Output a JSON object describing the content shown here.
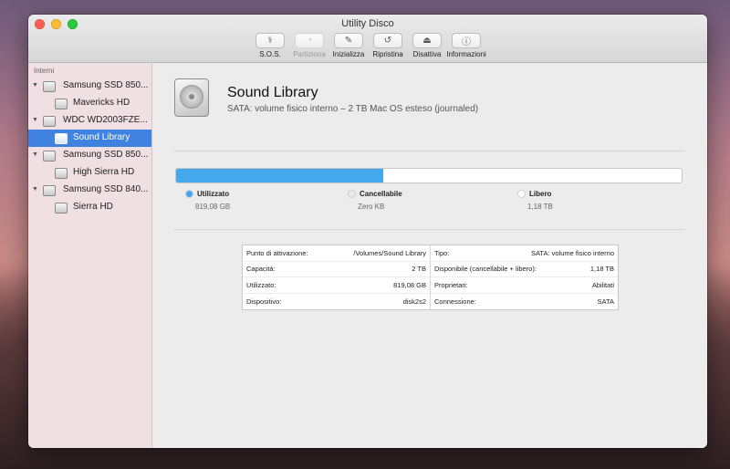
{
  "window": {
    "title": "Utility Disco"
  },
  "toolbar": [
    {
      "label": "S.O.S.",
      "icon": "stethoscope-icon",
      "glyph": "⚕",
      "enabled": true
    },
    {
      "label": "Partiziona",
      "icon": "pie-icon",
      "glyph": "◔",
      "enabled": false
    },
    {
      "label": "Inizializza",
      "icon": "erase-icon",
      "glyph": "✎",
      "enabled": true
    },
    {
      "label": "Ripristina",
      "icon": "restore-icon",
      "glyph": "↺",
      "enabled": true
    },
    {
      "label": "Disattiva",
      "icon": "unmount-icon",
      "glyph": "⏏",
      "enabled": true
    },
    {
      "label": "Informazioni",
      "icon": "info-icon",
      "glyph": "ⓘ",
      "enabled": true
    }
  ],
  "sidebar": {
    "header": "Interni",
    "items": [
      {
        "label": "Samsung SSD 850...",
        "level": "disk",
        "expanded": true,
        "selected": false
      },
      {
        "label": "Mavericks HD",
        "level": "vol",
        "selected": false
      },
      {
        "label": "WDC WD2003FZE...",
        "level": "disk",
        "expanded": true,
        "selected": false
      },
      {
        "label": "Sound Library",
        "level": "vol",
        "selected": true
      },
      {
        "label": "Samsung SSD 850...",
        "level": "disk",
        "expanded": true,
        "selected": false
      },
      {
        "label": "High Sierra HD",
        "level": "vol",
        "selected": false
      },
      {
        "label": "Samsung SSD 840...",
        "level": "disk",
        "expanded": true,
        "selected": false
      },
      {
        "label": "Sierra HD",
        "level": "vol",
        "selected": false
      }
    ]
  },
  "volume": {
    "name": "Sound Library",
    "description": "SATA: volume fisico interno – 2 TB Mac OS esteso (journaled)"
  },
  "usage": {
    "used_fraction": 0.41,
    "colors": {
      "used": "#43a8ec",
      "free": "#ffffff"
    },
    "legend": [
      {
        "name": "Utilizzato",
        "value": "819,08 GB",
        "color": "#43a8ec"
      },
      {
        "name": "Cancellabile",
        "value": "Zero KB",
        "color": "#e8e8e8"
      },
      {
        "name": "Libero",
        "value": "1,18 TB",
        "color": "#ffffff"
      }
    ]
  },
  "info": {
    "left": [
      {
        "label": "Punto di attivazione:",
        "value": "/Volumes/Sound Library"
      },
      {
        "label": "Capacità:",
        "value": "2 TB"
      },
      {
        "label": "Utilizzato:",
        "value": "819,08 GB"
      },
      {
        "label": "Dispositivo:",
        "value": "disk2s2"
      }
    ],
    "right": [
      {
        "label": "Tipo:",
        "value": "SATA: volume fisico interno"
      },
      {
        "label": "Disponibile (cancellabile + libero):",
        "value": "1,18 TB"
      },
      {
        "label": "Proprietari:",
        "value": "Abilitati"
      },
      {
        "label": "Connessione:",
        "value": "SATA"
      }
    ]
  }
}
